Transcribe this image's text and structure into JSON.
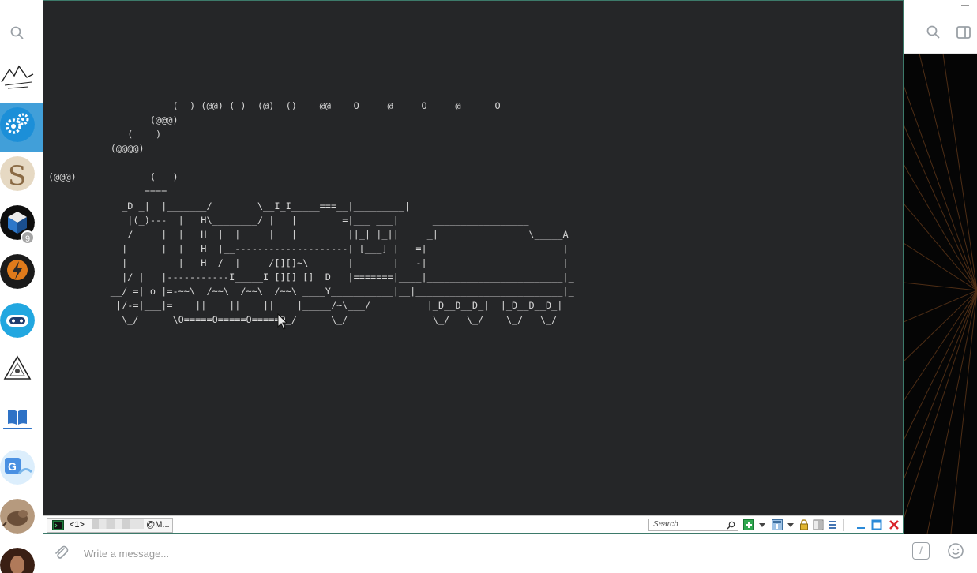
{
  "terminal": {
    "ascii_art": "                      (  ) (@@) ( )  (@)  ()    @@    O     @     O     @      O\n                  (@@@)\n              (    )\n           (@@@@)\n\n(@@@)             (   )\n                 ====        ________                ___________\n             _D _|  |_______/        \\__I_I_____===__|_________|\n              |(_)---  |   H\\________/ |   |        =|___ ___|      _________________\n              /     |  |   H  |  |     |   |         ||_| |_||     _|                \\_____A\n             |      |  |   H  |__--------------------| [___] |   =|                        |\n             | ________|___H__/__|_____/[][]~\\_______|       |   -|                        |\n             |/ |   |-----------I_____I [][] []  D   |=======|____|________________________|_\n           __/ =| o |=-~~\\  /~~\\  /~~\\  /~~\\ ____Y___________|__|__________________________|_\n            |/-=|___|=    ||    ||    ||    |_____/~\\___/          |_D__D__D_|  |_D__D__D_|\n             \\_/      \\O=====O=====O=====O_/      \\_/               \\_/   \\_/    \\_/   \\_/",
    "tab_number": "<1>",
    "tab_user_suffix": "@M...",
    "search_placeholder": "Search"
  },
  "composer": {
    "placeholder": "Write a message...",
    "command_label": "/"
  },
  "chat_list": {
    "badge_count": "9"
  },
  "colors": {
    "terminal_bg": "#252628",
    "terminal_fg": "#d6d6d6",
    "active_chat": "#419fd9"
  }
}
